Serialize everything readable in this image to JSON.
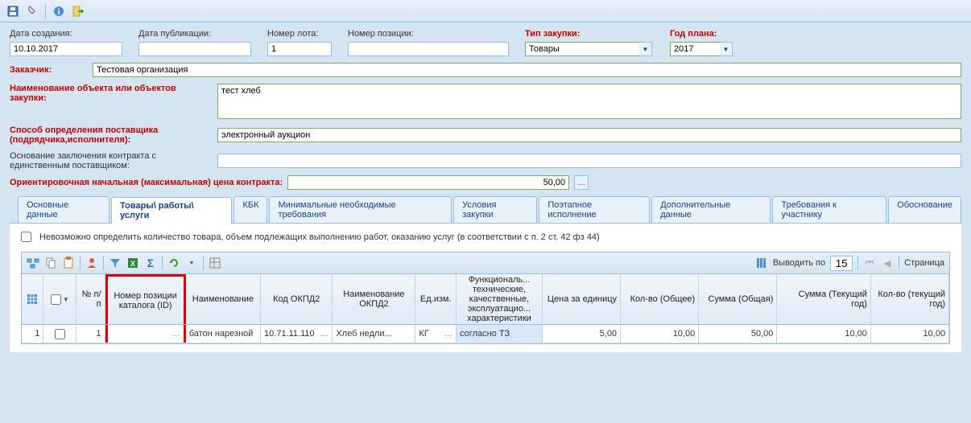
{
  "form": {
    "labels": {
      "date_created": "Дата создания:",
      "date_published": "Дата публикации:",
      "lot_number": "Номер лота:",
      "position_number": "Номер позиции:",
      "purchase_type": "Тип закупки:",
      "plan_year": "Год плана:",
      "customer": "Заказчик:",
      "object_name": "Наименование объекта или объектов закупки:",
      "supplier_method": "Способ определения поставщика (подрядчика,исполнителя):",
      "single_supplier_basis": "Основание заключения контракта с единственным поставщиком:",
      "price_label": "Ориентировочная начальная (максимальная) цена контракта:"
    },
    "values": {
      "date_created": "10.10.2017",
      "date_published": "",
      "lot_number": "1",
      "position_number": "",
      "purchase_type": "Товары",
      "plan_year": "2017",
      "customer": "Тестовая организация",
      "object_name": "тест хлеб",
      "supplier_method": "электронный аукцион",
      "single_supplier_basis": "",
      "price": "50,00"
    }
  },
  "tabs": [
    "Основные данные",
    "Товары\\ работы\\ услуги",
    "КБК",
    "Минимальные необходимые требования",
    "Условия закупки",
    "Поэтапное исполнение",
    "Дополнительные данные",
    "Требования к участнику",
    "Обоснование"
  ],
  "active_tab_index": 1,
  "checkbox_label": "Невозможно определить количество товара, объем подлежащих выполнению работ, оказанию услуг (в соответствии с п. 2 ст. 42 фз 44)",
  "pager": {
    "display_per": "Выводить по",
    "per_value": "15",
    "page_label": "Страница"
  },
  "grid": {
    "columns": [
      {
        "w": 28,
        "label": "",
        "icon": "grid"
      },
      {
        "w": 42,
        "label": "",
        "checkbox": true
      },
      {
        "w": 36,
        "label": "№ п/п",
        "align": "right"
      },
      {
        "w": 103,
        "label": "Номер позиции каталога (ID)",
        "highlight": true
      },
      {
        "w": 96,
        "label": "Наименование"
      },
      {
        "w": 92,
        "label": "Код ОКПД2"
      },
      {
        "w": 106,
        "label": "Наименование ОКПД2"
      },
      {
        "w": 52,
        "label": "Ед.изм."
      },
      {
        "w": 110,
        "label": "Функциональ...\nтехнические, качественные, эксплуатацио...\nхарактеристики"
      },
      {
        "w": 100,
        "label": "Цена за единицу",
        "align": "right"
      },
      {
        "w": 100,
        "label": "Кол-во (Общее)",
        "align": "right"
      },
      {
        "w": 100,
        "label": "Сумма (Общая)",
        "align": "right"
      },
      {
        "w": 120,
        "label": "Сумма (Текущий год)",
        "align": "right"
      },
      {
        "w": 100,
        "label": "Кол-во (текущий год)",
        "align": "right"
      }
    ],
    "rows": [
      {
        "num": "1",
        "cat_id": "",
        "name": "батон нарезной",
        "okpd2": "10.71.11.110",
        "okpd2_name": "Хлеб недли...",
        "unit": "КГ",
        "chars": "согласно ТЗ",
        "price": "5,00",
        "qty": "10,00",
        "sum": "50,00",
        "sum_year": "10,00",
        "qty_year": "10,00"
      }
    ]
  }
}
